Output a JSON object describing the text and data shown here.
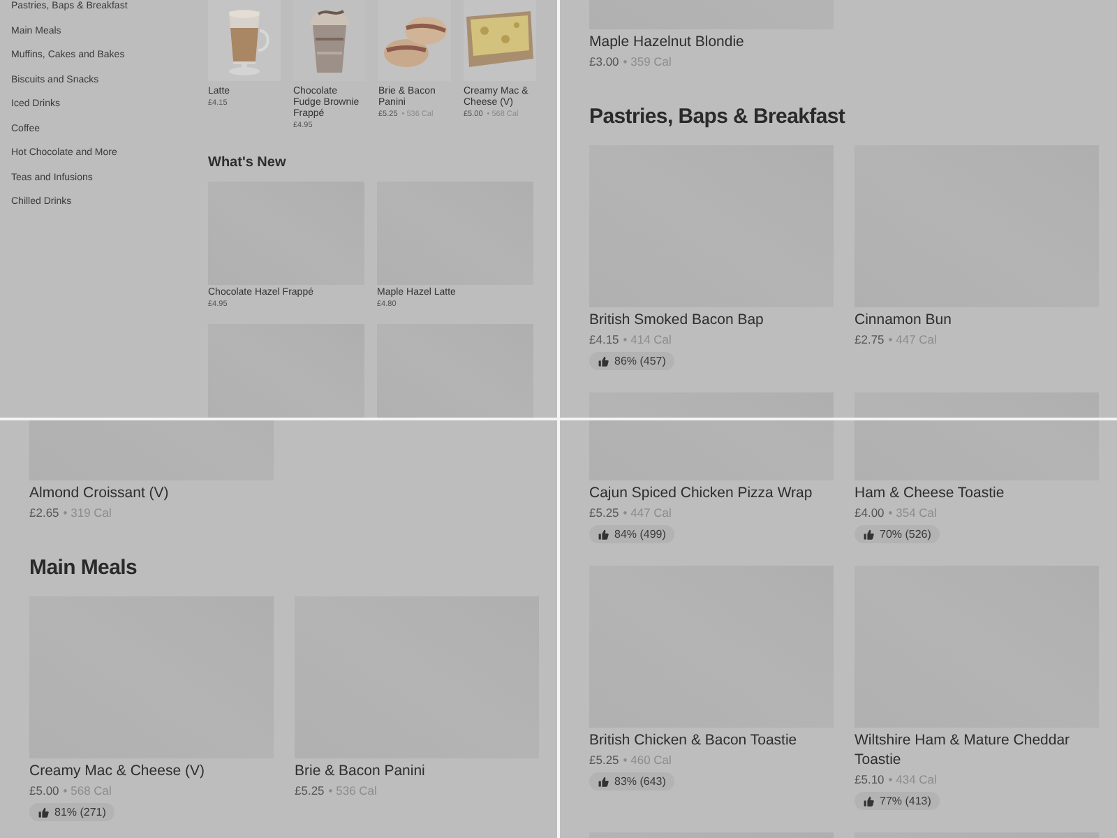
{
  "panels": [
    {
      "kind": "menu_overview",
      "sidebar": {
        "items": [
          {
            "label": "Pastries, Baps & Breakfast"
          },
          {
            "label": "Main Meals"
          },
          {
            "label": "Muffins, Cakes and Bakes"
          },
          {
            "label": "Biscuits and Snacks"
          },
          {
            "label": "Iced Drinks"
          },
          {
            "label": "Coffee"
          },
          {
            "label": "Hot Chocolate and More"
          },
          {
            "label": "Teas and Infusions"
          },
          {
            "label": "Chilled Drinks"
          }
        ]
      },
      "featured": [
        {
          "kind": "picture",
          "name": "Latte",
          "price": "£4.15"
        },
        {
          "kind": "picture",
          "name": "Chocolate Fudge Brownie Frappé",
          "price": "£4.95"
        },
        {
          "kind": "picture",
          "name": "Brie & Bacon Panini",
          "price": "£5.25",
          "calories": "• 536 Cal"
        },
        {
          "kind": "picture",
          "name": "Creamy Mac & Cheese (V)",
          "price": "£5.00",
          "calories": "• 568 Cal"
        }
      ],
      "whats_new": {
        "title": "What's New",
        "items": [
          {
            "kind": "placeholder",
            "name": "Chocolate Hazel Frappé",
            "price": "£4.95"
          },
          {
            "kind": "placeholder",
            "name": "Maple Hazel Latte",
            "price": "£4.80"
          },
          {
            "kind": "placeholder"
          },
          {
            "kind": "placeholder"
          }
        ]
      }
    },
    {
      "kind": "menu_grid",
      "sections": [
        {
          "items": [
            {
              "kind": "placeholder",
              "name": "Maple Hazelnut Blondie",
              "price": "£3.00",
              "calories": "• 359 Cal"
            }
          ]
        },
        {
          "title": "Pastries, Baps & Breakfast",
          "items": [
            {
              "kind": "placeholder",
              "name": "British Smoked Bacon Bap",
              "price": "£4.15",
              "calories": "• 414 Cal",
              "rating": "86% (457)"
            },
            {
              "kind": "placeholder",
              "name": "Cinnamon Bun",
              "price": "£2.75",
              "calories": "• 447 Cal"
            },
            {
              "kind": "placeholder"
            },
            {
              "kind": "placeholder"
            }
          ]
        }
      ]
    },
    {
      "kind": "menu_grid",
      "sections": [
        {
          "items": [
            {
              "kind": "placeholder",
              "name": "Almond Croissant (V)",
              "price": "£2.65",
              "calories": "• 319 Cal"
            }
          ]
        },
        {
          "title": "Main Meals",
          "items": [
            {
              "kind": "placeholder",
              "name": "Creamy Mac & Cheese (V)",
              "price": "£5.00",
              "calories": "• 568 Cal",
              "rating": "81% (271)"
            },
            {
              "kind": "placeholder",
              "name": "Brie & Bacon Panini",
              "price": "£5.25",
              "calories": "• 536 Cal"
            }
          ]
        }
      ]
    },
    {
      "kind": "menu_grid",
      "sections": [
        {
          "items": [
            {
              "kind": "placeholder",
              "name": "Cajun Spiced Chicken Pizza Wrap",
              "price": "£5.25",
              "calories": "• 447 Cal",
              "rating": "84% (499)"
            },
            {
              "kind": "placeholder",
              "name": "Ham & Cheese Toastie",
              "price": "£4.00",
              "calories": "• 354 Cal",
              "rating": "70% (526)"
            },
            {
              "kind": "placeholder",
              "name": "British Chicken & Bacon Toastie",
              "price": "£5.25",
              "calories": "• 460 Cal",
              "rating": "83% (643)"
            },
            {
              "kind": "placeholder",
              "name": "Wiltshire Ham & Mature Cheddar Toastie",
              "price": "£5.10",
              "calories": "• 434 Cal",
              "rating": "77% (413)"
            },
            {
              "kind": "placeholder"
            },
            {
              "kind": "placeholder"
            }
          ]
        }
      ]
    }
  ]
}
